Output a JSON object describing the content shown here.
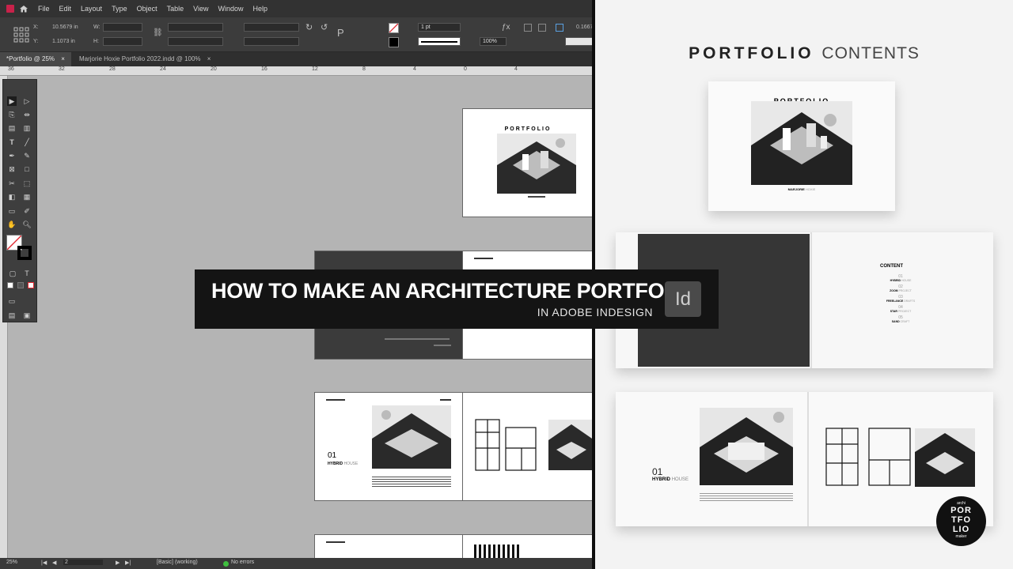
{
  "menu": {
    "items": [
      "File",
      "Edit",
      "Layout",
      "Type",
      "Object",
      "Table",
      "View",
      "Window",
      "Help"
    ]
  },
  "control": {
    "x_label": "X:",
    "x_value": "10.5679 in",
    "y_label": "Y:",
    "y_value": "1.1073 in",
    "w_label": "W:",
    "h_label": "H:",
    "stroke_weight": "1 pt",
    "scale": "100%",
    "offset_value": "0.1667"
  },
  "tabs": [
    {
      "label": "*Portfolio @ 25%",
      "close": "×"
    },
    {
      "label": "Marjorie Hoxie Portfolio 2022.indd @ 100%",
      "close": "×"
    }
  ],
  "ruler": {
    "ticks": [
      "36",
      "32",
      "28",
      "24",
      "20",
      "16",
      "12",
      "8",
      "4",
      "0",
      "4"
    ]
  },
  "status": {
    "zoom": "25%",
    "page": "2",
    "style": "[Basic] (working)",
    "errors": "No errors"
  },
  "pages": {
    "cover_title": "PORTFOLIO",
    "project_number": "01",
    "project_name_bold": "HYBRID",
    "project_name_light": "HOUSE"
  },
  "preview": {
    "title_bold": "PORTFOLIO",
    "title_light": "CONTENTS",
    "cover_title": "PORTFOLIO",
    "cover_author_bold": "MARJORIE",
    "cover_author_light": "HOXIE",
    "contents_heading": "CONTENT",
    "contents_items": [
      {
        "num": "01",
        "bold": "HYBRID",
        "light": "HOUSE"
      },
      {
        "num": "02",
        "bold": "ZOOM",
        "light": "PROJECT"
      },
      {
        "num": "03",
        "bold": "FREELANCE",
        "light": "DRAFTS"
      },
      {
        "num": "04",
        "bold": "STAR",
        "light": "PROJECT"
      },
      {
        "num": "05",
        "bold": "SAND",
        "light": "CRAFT"
      }
    ],
    "spread_number": "01",
    "spread_name_bold": "HYBRID",
    "spread_name_light": "HOUSE"
  },
  "banner": {
    "title": "HOW TO MAKE AN ARCHITECTURE PORTFOLIO",
    "subtitle": "IN ADOBE INDESIGN",
    "logo_text": "Id"
  },
  "badge": {
    "top": "archi",
    "line1": "POR",
    "line2": "TFO",
    "line3": "LIO",
    "bottom": "maker"
  }
}
